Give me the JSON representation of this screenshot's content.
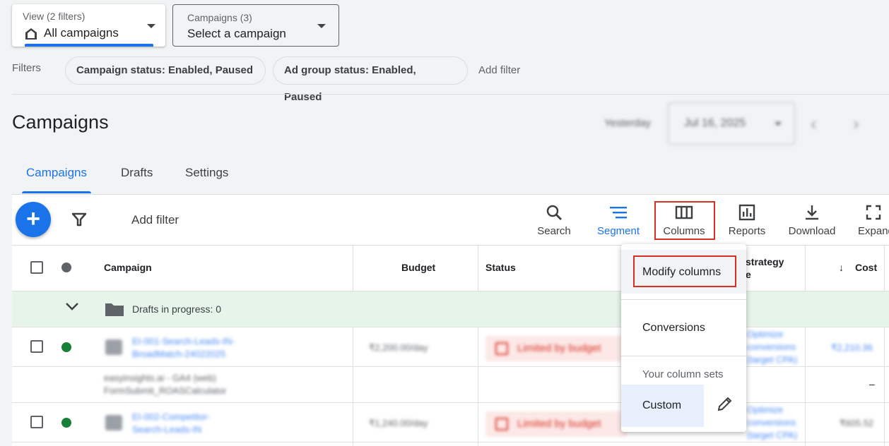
{
  "view_selector": {
    "label": "View (2 filters)",
    "value": "All campaigns"
  },
  "campaign_selector": {
    "label": "Campaigns (3)",
    "value": "Select a campaign"
  },
  "filters": {
    "label": "Filters",
    "chips": [
      "Campaign status: Enabled, Paused",
      "Ad group status: Enabled, Paused"
    ],
    "add_label": "Add filter"
  },
  "page_title": "Campaigns",
  "date_range": {
    "preset": "Yesterday",
    "value": "Jul 16, 2025"
  },
  "tabs": [
    "Campaigns",
    "Drafts",
    "Settings"
  ],
  "toolbar": {
    "add_filter": "Add filter",
    "buttons": [
      "Search",
      "Segment",
      "Columns",
      "Reports",
      "Download",
      "Expand"
    ]
  },
  "table": {
    "headers": {
      "campaign": "Campaign",
      "budget": "Budget",
      "status": "Status",
      "bid_strategy": "strategy",
      "bid_strategy_2": "e",
      "cost": "Cost"
    },
    "drafts": "Drafts in progress: 0",
    "rows": [
      {
        "name": [
          "EI-001-Search-Leads-IN-",
          "BroadMatch-24022025"
        ],
        "budget": "₹2,200.00/day",
        "status": "Limited by budget",
        "bid": [
          "Optimize",
          "conversions",
          "(target CPA)"
        ],
        "cost": "₹2,210.36"
      },
      {
        "name": [
          "easyinsights.ai - GA4 (web)",
          "FormSubmit_ROASCalculator"
        ],
        "cost": "–"
      },
      {
        "name": [
          "EI-002-Competitor-",
          "Search-Leads-IN"
        ],
        "budget": "₹1,240.00/day",
        "status": "Limited by budget",
        "bid": [
          "Optimize",
          "conversions",
          "(target CPA)"
        ],
        "cost": "₹605.52"
      }
    ]
  },
  "columns_menu": {
    "modify": "Modify columns",
    "conversions": "Conversions",
    "sets_header": "Your column sets",
    "custom": "Custom"
  },
  "colors": {
    "accent": "#1a73e8",
    "highlight": "#d93025",
    "drafts_bg": "#e6f4ea",
    "enabled": "#188038"
  }
}
